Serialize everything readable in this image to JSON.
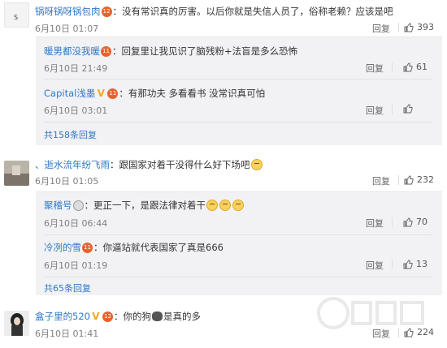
{
  "comments": [
    {
      "user": "锅呀锅呀锅包肉",
      "text": "：没有常识真的厉害。以后你就是失信人员了，俗称老赖？应该是吧",
      "time": "6月10日 01:07",
      "reply_label": "回复",
      "likes": "393",
      "replies": [
        {
          "user": "暖男都没我暖",
          "text": "：回复里让我见识了脑残粉+法盲是多么恐怖",
          "time": "6月10日 21:49",
          "reply_label": "回复",
          "likes": "61"
        },
        {
          "user": "Capital浅墨",
          "text": "：有那功夫 多看看书 没常识真可怕",
          "time": "6月10日 03:01",
          "reply_label": "回复",
          "likes": ""
        }
      ],
      "more": "共158条回复"
    },
    {
      "user": "、逝水流年纷飞雨",
      "text": "：跟国家对着干没得什么好下场吧",
      "time": "6月10日 01:05",
      "reply_label": "回复",
      "likes": "232",
      "replies": [
        {
          "user": "聚稽号",
          "text": "：更正一下，是跟法律对着干",
          "time": "6月10日 06:44",
          "reply_label": "回复",
          "likes": "70"
        },
        {
          "user": "冷冽的雪",
          "text": "：你逼站就代表国家了真是666",
          "time": "6月10日 01:19",
          "reply_label": "回复",
          "likes": "13"
        }
      ],
      "more": "共65条回复"
    },
    {
      "user": "盒子里的520",
      "text": "：你的狗",
      "text2": "是真的多",
      "time": "6月10日 01:41",
      "reply_label": "回复",
      "likes": "224"
    }
  ],
  "colors": {
    "name": "#2e78c8",
    "text": "#333333",
    "meta": "#808080",
    "reply_bg": "#f2f2f5",
    "badge": "#e8632b"
  }
}
